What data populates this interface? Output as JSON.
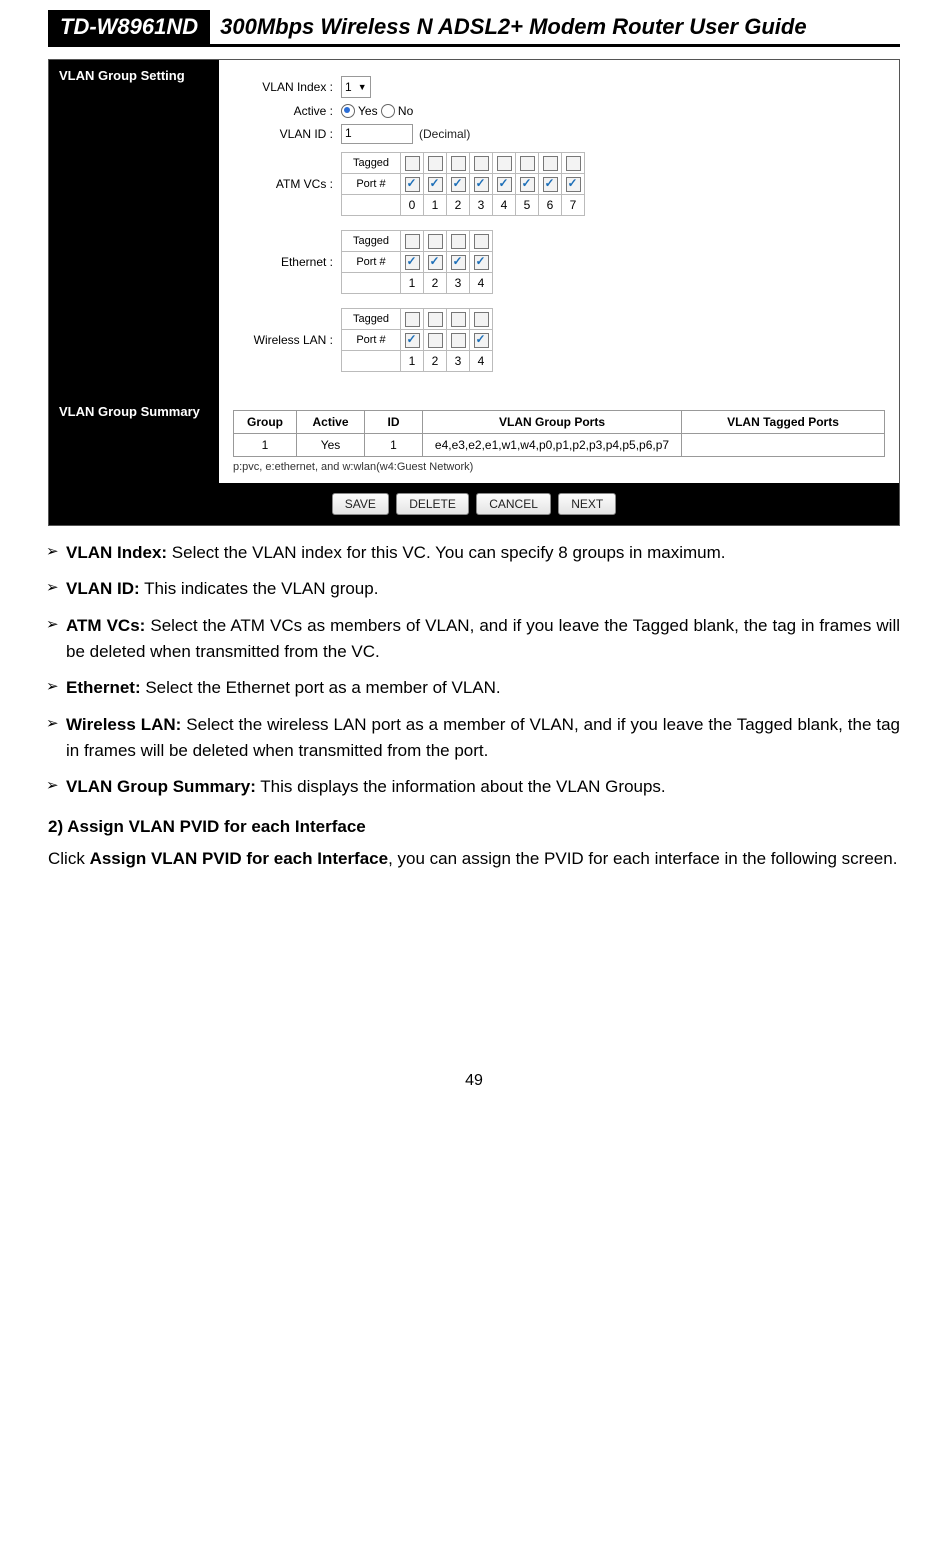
{
  "header": {
    "model": "TD-W8961ND",
    "title": "300Mbps Wireless N ADSL2+ Modem Router User Guide"
  },
  "screenshot": {
    "section1_title": "VLAN Group Setting",
    "section2_title": "VLAN Group Summary",
    "form": {
      "vlan_index_label": "VLAN Index :",
      "vlan_index_value": "1",
      "active_label": "Active :",
      "active_yes": "Yes",
      "active_no": "No",
      "vlan_id_label": "VLAN ID :",
      "vlan_id_value": "1",
      "vlan_id_hint": "(Decimal)",
      "atm_label": "ATM VCs :",
      "eth_label": "Ethernet :",
      "wlan_label": "Wireless LAN :",
      "row_tagged": "Tagged",
      "row_port": "Port #"
    },
    "atm_ports": [
      "0",
      "1",
      "2",
      "3",
      "4",
      "5",
      "6",
      "7"
    ],
    "atm_tagged": [
      false,
      false,
      false,
      false,
      false,
      false,
      false,
      false
    ],
    "atm_port": [
      true,
      true,
      true,
      true,
      true,
      true,
      true,
      true
    ],
    "eth_ports": [
      "1",
      "2",
      "3",
      "4"
    ],
    "eth_tagged": [
      false,
      false,
      false,
      false
    ],
    "eth_port": [
      true,
      true,
      true,
      true
    ],
    "wlan_ports": [
      "1",
      "2",
      "3",
      "4"
    ],
    "wlan_tagged": [
      false,
      false,
      false,
      false
    ],
    "wlan_port": [
      true,
      false,
      false,
      true
    ],
    "summary": {
      "headers": [
        "Group",
        "Active",
        "ID",
        "VLAN Group Ports",
        "VLAN Tagged Ports"
      ],
      "row": {
        "group": "1",
        "active": "Yes",
        "id": "1",
        "group_ports": "e4,e3,e2,e1,w1,w4,p0,p1,p2,p3,p4,p5,p6,p7",
        "tagged_ports": ""
      },
      "legend": "p:pvc, e:ethernet, and w:wlan(w4:Guest Network)"
    },
    "buttons": {
      "save": "SAVE",
      "delete": "DELETE",
      "cancel": "CANCEL",
      "next": "NEXT"
    }
  },
  "definitions": {
    "vlan_index_term": "VLAN Index:",
    "vlan_index_text": " Select the VLAN index for this VC. You can specify 8 groups in maximum.",
    "vlan_id_term": "VLAN ID:",
    "vlan_id_text": " This indicates the VLAN group.",
    "atm_term": "ATM VCs:",
    "atm_text": " Select the ATM VCs as members of VLAN, and if you leave the Tagged blank, the tag in frames will be deleted when transmitted from the VC.",
    "eth_term": "Ethernet:",
    "eth_text": " Select the Ethernet port as a member of VLAN.",
    "wlan_term": "Wireless LAN:",
    "wlan_text": " Select the wireless LAN port as a member of VLAN, and if you leave the Tagged blank, the tag in frames will be deleted when transmitted from the port.",
    "summary_term": "VLAN Group Summary:",
    "summary_text": " This displays the information about the VLAN Groups."
  },
  "section2": {
    "heading": "2)    Assign VLAN PVID for each Interface",
    "para_prefix": "Click ",
    "para_bold": "Assign VLAN PVID for each Interface",
    "para_suffix": ", you can assign the PVID for each interface in the following screen."
  },
  "page_number": "49"
}
